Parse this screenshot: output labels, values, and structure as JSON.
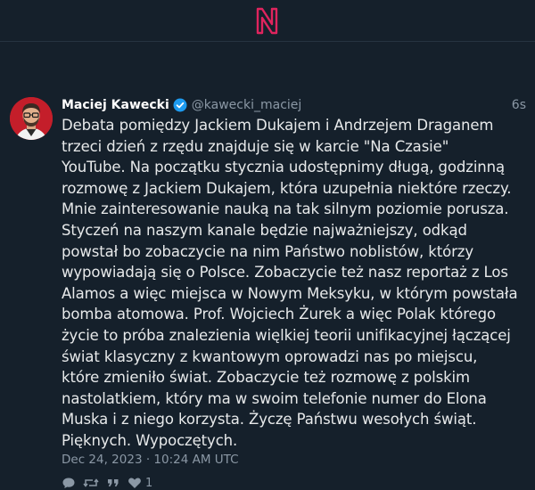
{
  "app": {
    "logo_icon": "netlify-like-N-logo",
    "brand_color": "#e0245e"
  },
  "tweet": {
    "author_name": "Maciej Kawecki",
    "handle": "@kawecki_maciej",
    "verified": true,
    "time_ago": "6s",
    "text": "Debata pomiędzy Jackiem Dukajem i Andrzejem Draganem\ntrzeci dzień z rzędu znajduje się w karcie \"Na Czasie\"\nYouTube. Na początku stycznia udostępnimy długą, godzinną\nrozmowę z Jackiem Dukajem, która uzupełnia niektóre rzeczy.\nMnie zainteresowanie nauką na tak silnym poziomie porusza.\nStyczeń na naszym kanale będzie najważniejszy, odkąd\npowstał bo zobaczycie na nim Państwo noblistów, którzy\nwypowiadają się o Polsce. Zobaczycie też nasz reportaż z Los\nAlamos a więc miejsca w Nowym Meksyku, w którym powstała\nbomba atomowa. Prof. Wojciech Żurek a więc Polak którego\nżycie to próba znalezienia więlkiej teorii unifikacyjnej łączącej\nświat klasyczny z kwantowym oprowadzi nas po miejscu,\nktóre zmieniło świat. Zobaczycie też rozmowę z polskim\nnastolatkiem, który ma w swoim telefonie numer do Elona\nMuska i z niego korzysta. Życzę Państwu wesołych świąt.\nPięknych. Wypoczętych.",
    "date": "Dec 24, 2023 · 10:24 AM UTC",
    "actions": {
      "reply_icon": "reply-icon",
      "retweet_icon": "retweet-icon",
      "quote_icon": "quote-icon",
      "like_icon": "heart-icon",
      "like_count": "1"
    }
  },
  "colors": {
    "background": "#15202b",
    "text": "#e7e9ea",
    "muted": "#8b98a5",
    "verified": "#1d9bf0",
    "avatar_bg": "#c41e2a"
  }
}
